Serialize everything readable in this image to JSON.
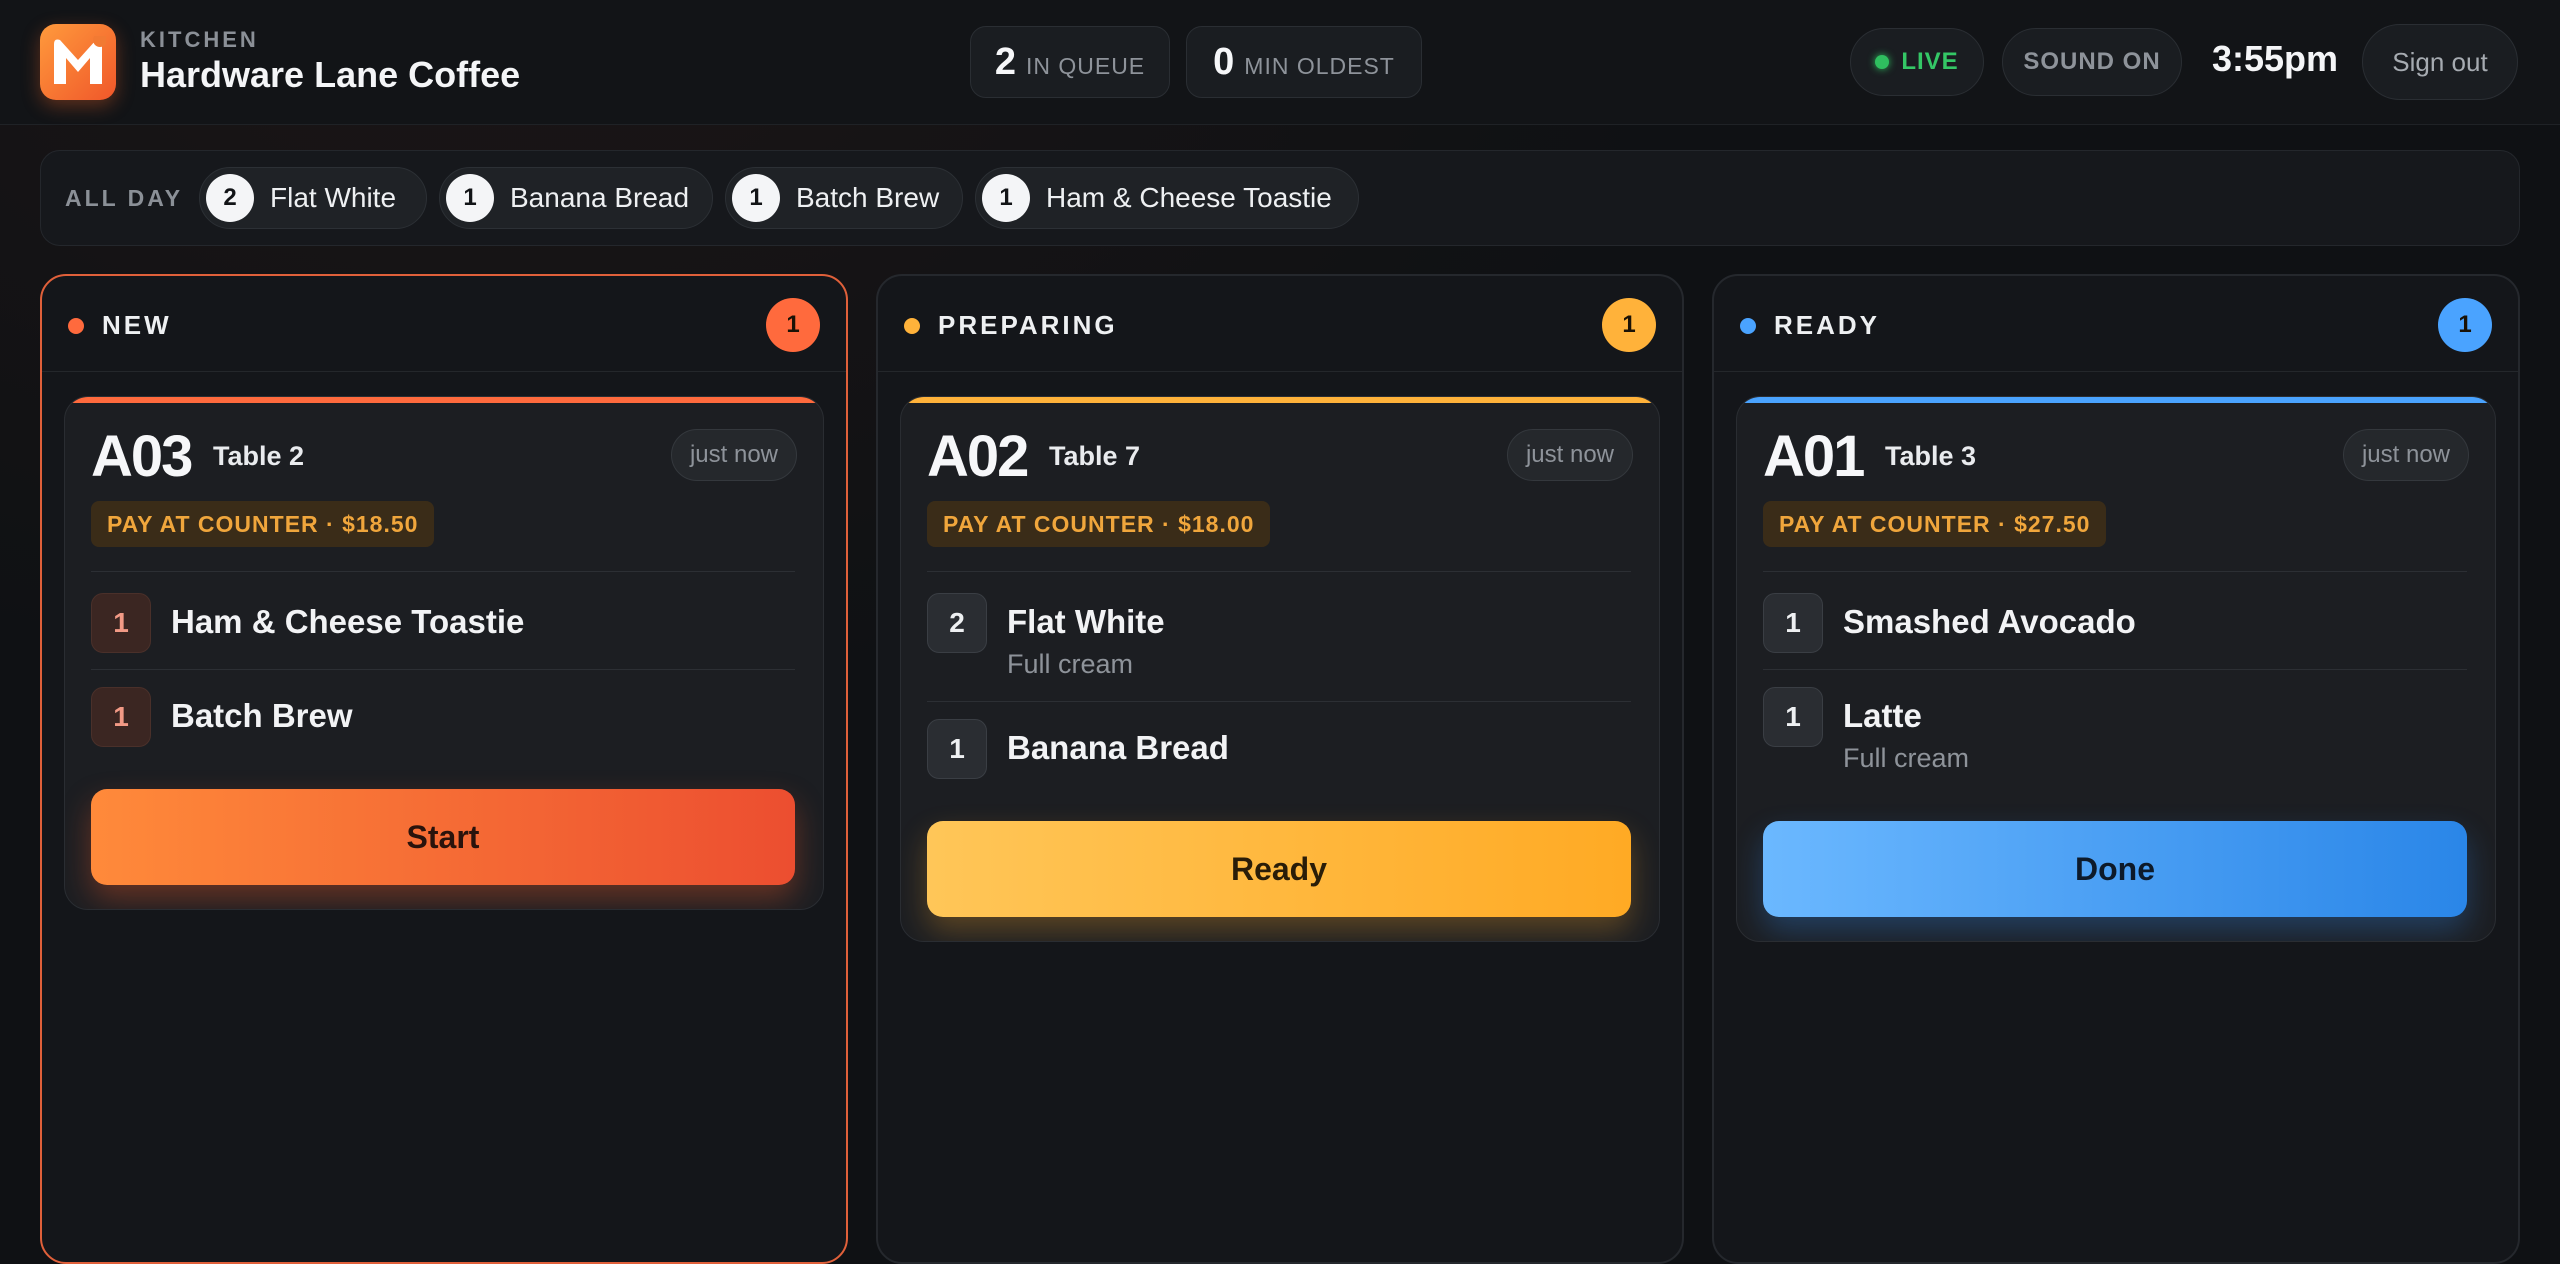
{
  "header": {
    "kicker": "KITCHEN",
    "venue": "Hardware Lane Coffee",
    "stats": [
      {
        "value": "2",
        "label": "IN QUEUE"
      },
      {
        "value": "0",
        "label": "MIN OLDEST"
      }
    ],
    "live_label": "LIVE",
    "sound_label": "SOUND ON",
    "clock": "3:55pm",
    "signout_label": "Sign out"
  },
  "allday": {
    "label": "ALL DAY",
    "chips": [
      {
        "qty": "2",
        "name": "Flat White"
      },
      {
        "qty": "1",
        "name": "Banana Bread"
      },
      {
        "qty": "1",
        "name": "Batch Brew"
      },
      {
        "qty": "1",
        "name": "Ham & Cheese Toastie"
      }
    ]
  },
  "columns": [
    {
      "title": "NEW",
      "count": "1",
      "accent": "#ff6a3d",
      "order": {
        "number": "A03",
        "table": "Table 2",
        "time": "just now",
        "payment": "PAY AT COUNTER · $18.50",
        "items": [
          {
            "qty": "1",
            "name": "Ham & Cheese Toastie",
            "mod": ""
          },
          {
            "qty": "1",
            "name": "Batch Brew",
            "mod": ""
          }
        ],
        "action": "Start"
      }
    },
    {
      "title": "PREPARING",
      "count": "1",
      "accent": "#ffb23a",
      "order": {
        "number": "A02",
        "table": "Table 7",
        "time": "just now",
        "payment": "PAY AT COUNTER · $18.00",
        "items": [
          {
            "qty": "2",
            "name": "Flat White",
            "mod": "Full cream"
          },
          {
            "qty": "1",
            "name": "Banana Bread",
            "mod": ""
          }
        ],
        "action": "Ready"
      }
    },
    {
      "title": "READY",
      "count": "1",
      "accent": "#4aa3ff",
      "order": {
        "number": "A01",
        "table": "Table 3",
        "time": "just now",
        "payment": "PAY AT COUNTER · $27.50",
        "items": [
          {
            "qty": "1",
            "name": "Smashed Avocado",
            "mod": ""
          },
          {
            "qty": "1",
            "name": "Latte",
            "mod": "Full cream"
          }
        ],
        "action": "Done"
      }
    }
  ]
}
